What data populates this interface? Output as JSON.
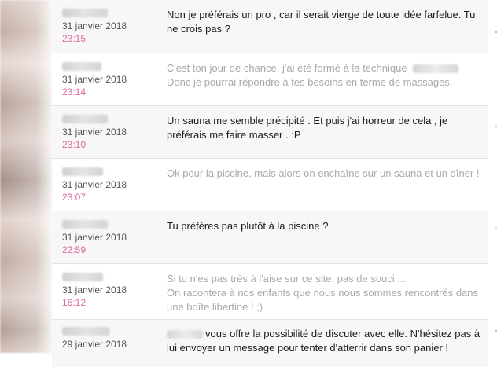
{
  "messages": [
    {
      "date": "31 janvier 2018",
      "time": "23:15",
      "text": "Non je préférais un pro , car il serait vierge de toute idée farfelue. Tu ne crois pas ?",
      "faded": false
    },
    {
      "date": "31 janvier 2018",
      "time": "23:14",
      "text_before_blur": "C'est ton jour de chance, j'ai été formé à la technique",
      "text_after_blur": "Donc je pourrai répondre à tes besoins en terme de massages.",
      "faded": true
    },
    {
      "date": "31 janvier 2018",
      "time": "23:10",
      "text": "Un sauna me semble précipité . Et puis j'ai horreur de cela , je préférais me faire masser . :P",
      "faded": false
    },
    {
      "date": "31 janvier 2018",
      "time": "23:07",
      "text": "Ok pour la piscine, mais alors on enchaîne sur un sauna et un dîner !",
      "faded": true
    },
    {
      "date": "31 janvier 2018",
      "time": "22:59",
      "text": "Tu préfères pas plutôt à la piscine ?",
      "faded": false
    },
    {
      "date": "31 janvier 2018",
      "time": "16:12",
      "line1": "Si tu n'es pas très à l'aise sur ce site, pas de souci ...",
      "line2": "On racontera à nos enfants que nous nous sommes rencontrés dans une boîte libertine ! ;)",
      "faded": true
    },
    {
      "date": "29 janvier 2018",
      "time": "",
      "text_after_blur": "vous offre la possibilité de discuter avec elle. N'hésitez pas à lui envoyer un message pour tenter d'atterrir dans son panier !",
      "faded": false
    }
  ],
  "colors": {
    "time_accent": "#e06aa0",
    "faded_text": "#a9a9a9",
    "divider": "#e4e4e4"
  }
}
